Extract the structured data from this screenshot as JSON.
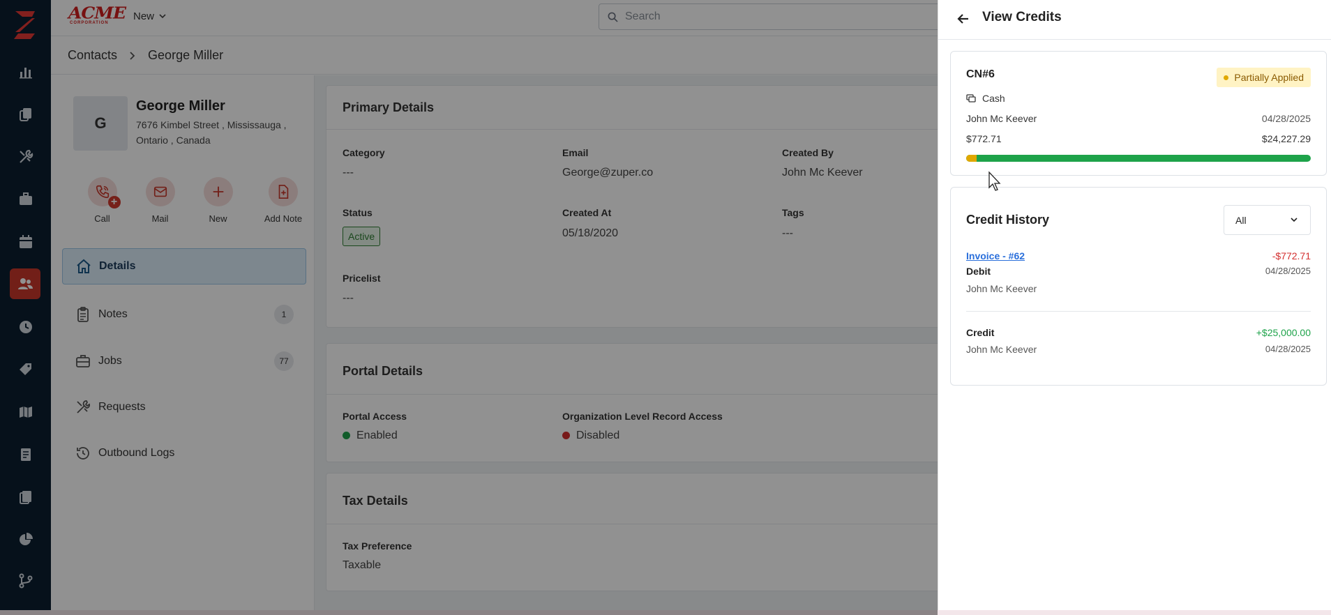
{
  "topbar": {
    "brand_name": "ACME",
    "brand_sub": "CORPORATION",
    "new_label": "New",
    "search_placeholder": "Search"
  },
  "breadcrumb": {
    "parent": "Contacts",
    "current": "George Miller"
  },
  "contact": {
    "initial": "G",
    "name": "George Miller",
    "address": "7676 Kimbel Street , Mississauga , Ontario , Canada"
  },
  "quick_actions": [
    {
      "label": "Call",
      "icon": "phone-plus-icon"
    },
    {
      "label": "Mail",
      "icon": "mail-icon"
    },
    {
      "label": "New",
      "icon": "plus-icon"
    },
    {
      "label": "Add Note",
      "icon": "note-add-icon"
    }
  ],
  "nav": [
    {
      "label": "Details",
      "icon": "home-icon",
      "active": true
    },
    {
      "label": "Notes",
      "icon": "clipboard-icon",
      "count": "1"
    },
    {
      "label": "Jobs",
      "icon": "briefcase-icon",
      "count": "77"
    },
    {
      "label": "Requests",
      "icon": "tools-icon"
    },
    {
      "label": "Outbound Logs",
      "icon": "history-icon"
    }
  ],
  "primary_details": {
    "title": "Primary Details",
    "category_label": "Category",
    "category_value": "---",
    "email_label": "Email",
    "email_value": "George@zuper.co",
    "created_by_label": "Created By",
    "created_by_value": "John Mc Keever",
    "status_label": "Status",
    "status_value": "Active",
    "created_at_label": "Created At",
    "created_at_value": "05/18/2020",
    "tags_label": "Tags",
    "tags_value": "---",
    "pricelist_label": "Pricelist",
    "pricelist_value": "---"
  },
  "portal_details": {
    "title": "Portal Details",
    "portal_access_label": "Portal Access",
    "portal_access_value": "Enabled",
    "org_access_label": "Organization Level Record Access",
    "org_access_value": "Disabled",
    "enabled_color": "#1ea34a",
    "disabled_color": "#d32f2f"
  },
  "tax_details": {
    "title": "Tax Details",
    "tax_pref_label": "Tax Preference",
    "tax_pref_value": "Taxable"
  },
  "drawer": {
    "title": "View Credits",
    "credit_note": {
      "id": "CN#6",
      "status": "Partially Applied",
      "payment_method": "Cash",
      "created_by": "John Mc Keever",
      "date": "04/28/2025",
      "applied_amount": "$772.71",
      "remaining_amount": "$24,227.29",
      "applied_fraction": 0.0309
    },
    "history": {
      "title": "Credit History",
      "filter_value": "All",
      "entries": [
        {
          "link": "Invoice - #62",
          "type": "Debit",
          "user": "John Mc Keever",
          "amount": "-$772.71",
          "date": "04/28/2025"
        },
        {
          "type": "Credit",
          "user": "John Mc Keever",
          "amount": "+$25,000.00",
          "date": "04/28/2025"
        }
      ]
    }
  },
  "colors": {
    "accent": "#c8372b",
    "rail_bg": "#0b1f30",
    "debit": "#d32f2f",
    "credit": "#1ea34a",
    "link": "#2a6fdb"
  }
}
